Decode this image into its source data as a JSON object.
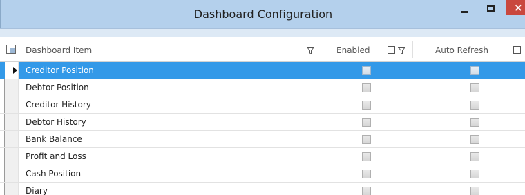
{
  "window": {
    "title": "Dashboard Configuration",
    "close_glyph": "×"
  },
  "grid": {
    "columns": {
      "item": "Dashboard Item",
      "enabled": "Enabled",
      "auto_refresh": "Auto Refresh"
    },
    "selected_index": 0,
    "rows": [
      {
        "label": "Creditor Position",
        "enabled": false,
        "auto_refresh": false
      },
      {
        "label": "Debtor Position",
        "enabled": false,
        "auto_refresh": false
      },
      {
        "label": "Creditor History",
        "enabled": false,
        "auto_refresh": false
      },
      {
        "label": "Debtor History",
        "enabled": false,
        "auto_refresh": false
      },
      {
        "label": "Bank Balance",
        "enabled": false,
        "auto_refresh": false
      },
      {
        "label": "Profit and Loss",
        "enabled": false,
        "auto_refresh": false
      },
      {
        "label": "Cash Position",
        "enabled": false,
        "auto_refresh": false
      },
      {
        "label": "Diary",
        "enabled": false,
        "auto_refresh": false
      }
    ]
  },
  "colors": {
    "titlebar": "#b4d0ec",
    "selected_row": "#3399e8",
    "close_button": "#c9473d"
  },
  "icons": [
    "column-chooser-icon",
    "filter-icon",
    "row-pointer-icon",
    "minimize-icon",
    "maximize-icon",
    "close-icon"
  ]
}
